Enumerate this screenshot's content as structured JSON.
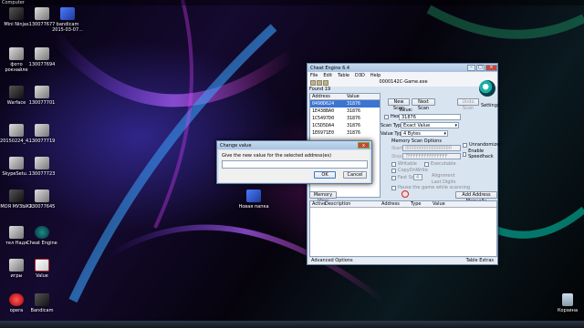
{
  "top_strip": {
    "label": "Computer"
  },
  "desktop_icons": [
    {
      "label": "Mini Ninjas",
      "icon": "game-icon"
    },
    {
      "label": "130077677",
      "icon": "image-icon"
    },
    {
      "label": "bandicam 2015-03-07...",
      "icon": "folder-icon"
    },
    {
      "label": "фото рокнайле",
      "icon": "photo-icon"
    },
    {
      "label": "130077694",
      "icon": "image-icon"
    },
    {
      "label": "Warface",
      "icon": "warface-icon"
    },
    {
      "label": "130077701",
      "icon": "image-icon"
    },
    {
      "label": "20150224_4...",
      "icon": "image-icon"
    },
    {
      "label": "130077719",
      "icon": "image-icon"
    },
    {
      "label": "SkypeSetu...",
      "icon": "skype-icon"
    },
    {
      "label": "130077723",
      "icon": "image-icon"
    },
    {
      "label": "МОЯ МУЗЫКА",
      "icon": "music-icon"
    },
    {
      "label": "130077645",
      "icon": "image-icon"
    },
    {
      "label": "тeл Надя",
      "icon": "image-icon"
    },
    {
      "label": "Cheat Engine",
      "icon": "cheat-engine-icon"
    },
    {
      "label": "игры",
      "icon": "folder-icon"
    },
    {
      "label": "Value",
      "icon": "pdf-icon"
    },
    {
      "label": "opera",
      "icon": "opera-icon"
    },
    {
      "label": "Bandicam",
      "icon": "bandicam-icon"
    },
    {
      "label": "Новая папка",
      "icon": "folder-icon"
    },
    {
      "label": "Корзина",
      "icon": "recycle-bin-icon"
    }
  ],
  "cheat_engine": {
    "title": "Cheat Engine 6.4",
    "menu": [
      "File",
      "Edit",
      "Table",
      "D3D",
      "Help"
    ],
    "process": "0000142C-Game.exe",
    "found": "Found 19",
    "columns": [
      "Address",
      "Value"
    ],
    "rows": [
      {
        "address": "0490D624",
        "value": "31876"
      },
      {
        "address": "1E438BA0",
        "value": "31876"
      },
      {
        "address": "1C5497D0",
        "value": "31876"
      },
      {
        "address": "1C5D5DA4",
        "value": "31876"
      },
      {
        "address": "1E6971E0",
        "value": "31876"
      }
    ],
    "buttons": {
      "new_scan": "New Scan",
      "next_scan": "Next Scan",
      "undo_scan": "Undo Scan",
      "memory_view": "Memory View",
      "add_address": "Add Address Manually"
    },
    "settings_label": "Settings",
    "value_label": "Value:",
    "hex_label": "Hex",
    "value_input": "31876",
    "scan_type_label": "Scan Type",
    "scan_type_value": "Exact Value",
    "value_type_label": "Value Type",
    "value_type_value": "4 Bytes",
    "memory_scan_options": "Memory Scan Options",
    "start_label": "Start",
    "start_value": "0000000000000000",
    "stop_label": "Stop",
    "stop_value": "7FFFFFFFFFFFFFFF",
    "writable": "Writable",
    "executable": "Executable",
    "copy_on_write": "CopyOnWrite",
    "fast_scan": "Fast Scan",
    "fast_scan_value": "4",
    "alignment": "Alignment",
    "last_digits": "Last Digits",
    "pause_game": "Pause the game while scanning",
    "unrandomizer": "Unrandomizer",
    "enable_speedhack": "Enable Speedhack",
    "lower_columns": [
      "Active",
      "Description",
      "Address",
      "Type",
      "Value"
    ],
    "advanced_options": "Advanced Options",
    "table_extras": "Table Extras"
  },
  "dialog": {
    "title": "Change value",
    "prompt": "Give the new value for the selected address(es)",
    "input_value": "",
    "ok": "OK",
    "cancel": "Cancel",
    "close": "x"
  }
}
